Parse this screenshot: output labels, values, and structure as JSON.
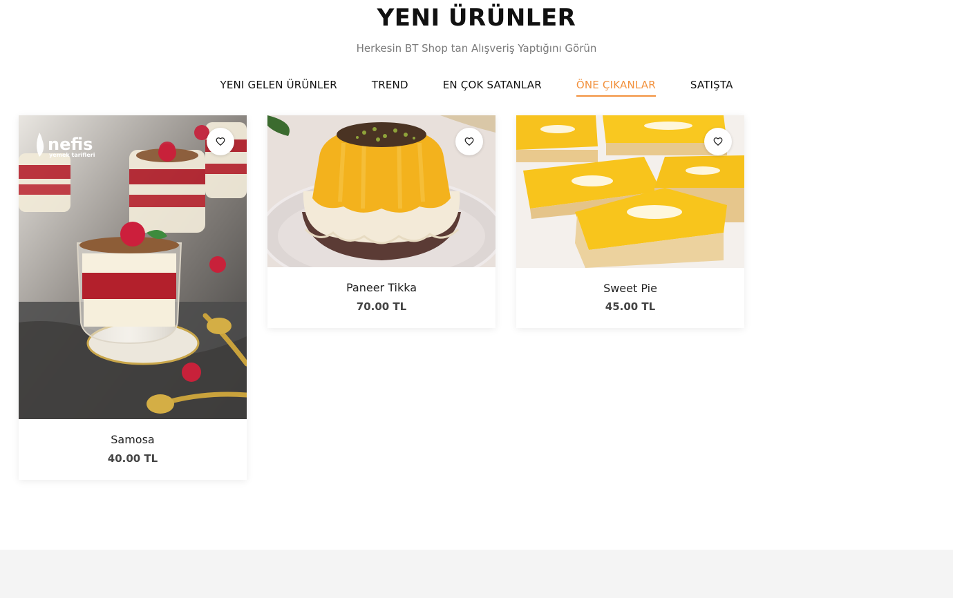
{
  "header": {
    "title": "YENI ÜRÜNLER",
    "subtitle": "Herkesin BT Shop tan Alışveriş Yaptığını Görün"
  },
  "tabs": [
    {
      "label": "YENI GELEN ÜRÜNLER",
      "active": false
    },
    {
      "label": "TREND",
      "active": false
    },
    {
      "label": "EN ÇOK SATANLAR",
      "active": false
    },
    {
      "label": "ÖNE ÇIKANLAR",
      "active": true
    },
    {
      "label": "SATIŞTA",
      "active": false
    }
  ],
  "products": [
    {
      "name": "Samosa",
      "price": "40.00 TL",
      "image": "layered-dessert-cups-photo",
      "watermark": "nefis yemek tarifleri"
    },
    {
      "name": "Paneer Tikka",
      "price": "70.00 TL",
      "image": "pudding-with-pistachio-photo"
    },
    {
      "name": "Sweet Pie",
      "price": "45.00 TL",
      "image": "lemon-bars-photo"
    }
  ],
  "colors": {
    "accent": "#f2913d",
    "footer_band": "#f4f4f4"
  },
  "icons": {
    "wishlist": "heart-icon"
  }
}
